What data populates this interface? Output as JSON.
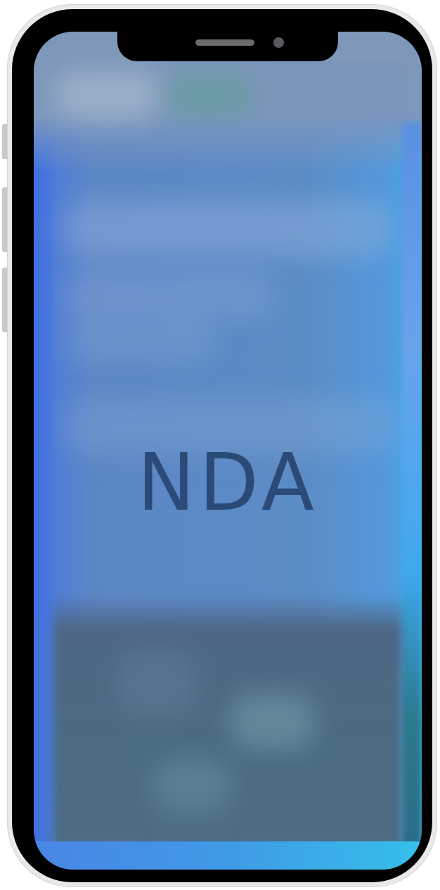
{
  "device": {
    "model": "phone-mockup",
    "frame_color": "#e9e9ea",
    "bezel_color": "#000000"
  },
  "screen": {
    "overlay_text": "NDA",
    "text_color": "#2b4a78",
    "content_state": "blurred"
  }
}
